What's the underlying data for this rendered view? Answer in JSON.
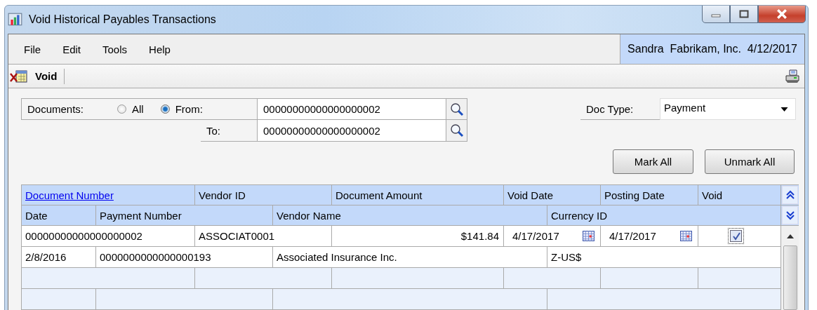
{
  "window": {
    "title": "Void Historical Payables Transactions"
  },
  "menu": [
    "File",
    "Edit",
    "Tools",
    "Help"
  ],
  "user_panel": "Sandra  Fabrikam, Inc.  4/12/2017",
  "toolbar": {
    "void_button": "Void"
  },
  "documents": {
    "label": "Documents:",
    "options": [
      {
        "label": "All",
        "selected": false
      },
      {
        "label": "From:",
        "selected": true
      }
    ],
    "from_value": "00000000000000000002",
    "to_label": "To:",
    "to_value": "00000000000000000002"
  },
  "doc_type": {
    "label": "Doc Type:",
    "value": "Payment"
  },
  "buttons": [
    "Mark All",
    "Unmark All"
  ],
  "table": {
    "columns": [
      "Document Number",
      "Vendor ID",
      "Document Amount",
      "Void Date",
      "Posting Date",
      "Void"
    ],
    "columns_line2": [
      "Date",
      "Payment Number",
      "Vendor Name",
      "Currency ID"
    ],
    "rows": [
      {
        "document_number": "00000000000000000002",
        "vendor_id": "ASSOCIAT0001",
        "document_amount": "$141.84",
        "void_date": "4/17/2017",
        "posting_date": "4/17/2017",
        "void": true,
        "date": "2/8/2016",
        "payment_number": "0000000000000000193",
        "vendor_name": "Associated Insurance Inc.",
        "currency_id": "Z-US$"
      }
    ]
  }
}
